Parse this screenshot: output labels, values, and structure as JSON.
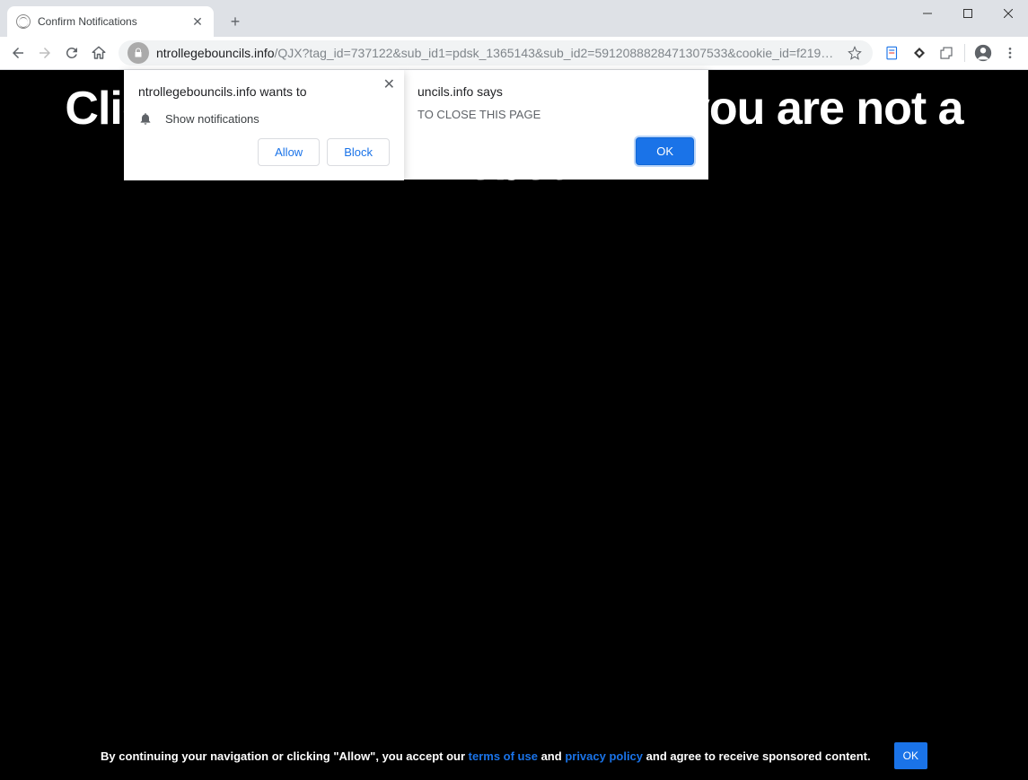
{
  "window": {
    "minimize": "—",
    "maximize": "◻",
    "close": "✕"
  },
  "tab": {
    "title": "Confirm Notifications"
  },
  "toolbar": {
    "url_domain": "ntrollegebouncils.info",
    "url_path": "/QJX?tag_id=737122&sub_id1=pdsk_1365143&sub_id2=5912088828471307533&cookie_id=f2194fbc..."
  },
  "page": {
    "headline_line1": "Click \"Allow\" to confirm that you are not a",
    "headline_line2": "robot!"
  },
  "perm_dialog": {
    "title": "ntrollegebouncils.info wants to",
    "row": "Show notifications",
    "allow": "Allow",
    "block": "Block"
  },
  "alert_dialog": {
    "title_suffix": "uncils.info says",
    "body_suffix": "TO CLOSE THIS PAGE",
    "ok": "OK"
  },
  "consent": {
    "prefix": "By continuing your navigation or clicking \"Allow\", you accept our ",
    "terms": "terms of use",
    "and": " and ",
    "privacy": "privacy policy",
    "suffix": " and agree to receive sponsored content.",
    "ok": "OK"
  }
}
